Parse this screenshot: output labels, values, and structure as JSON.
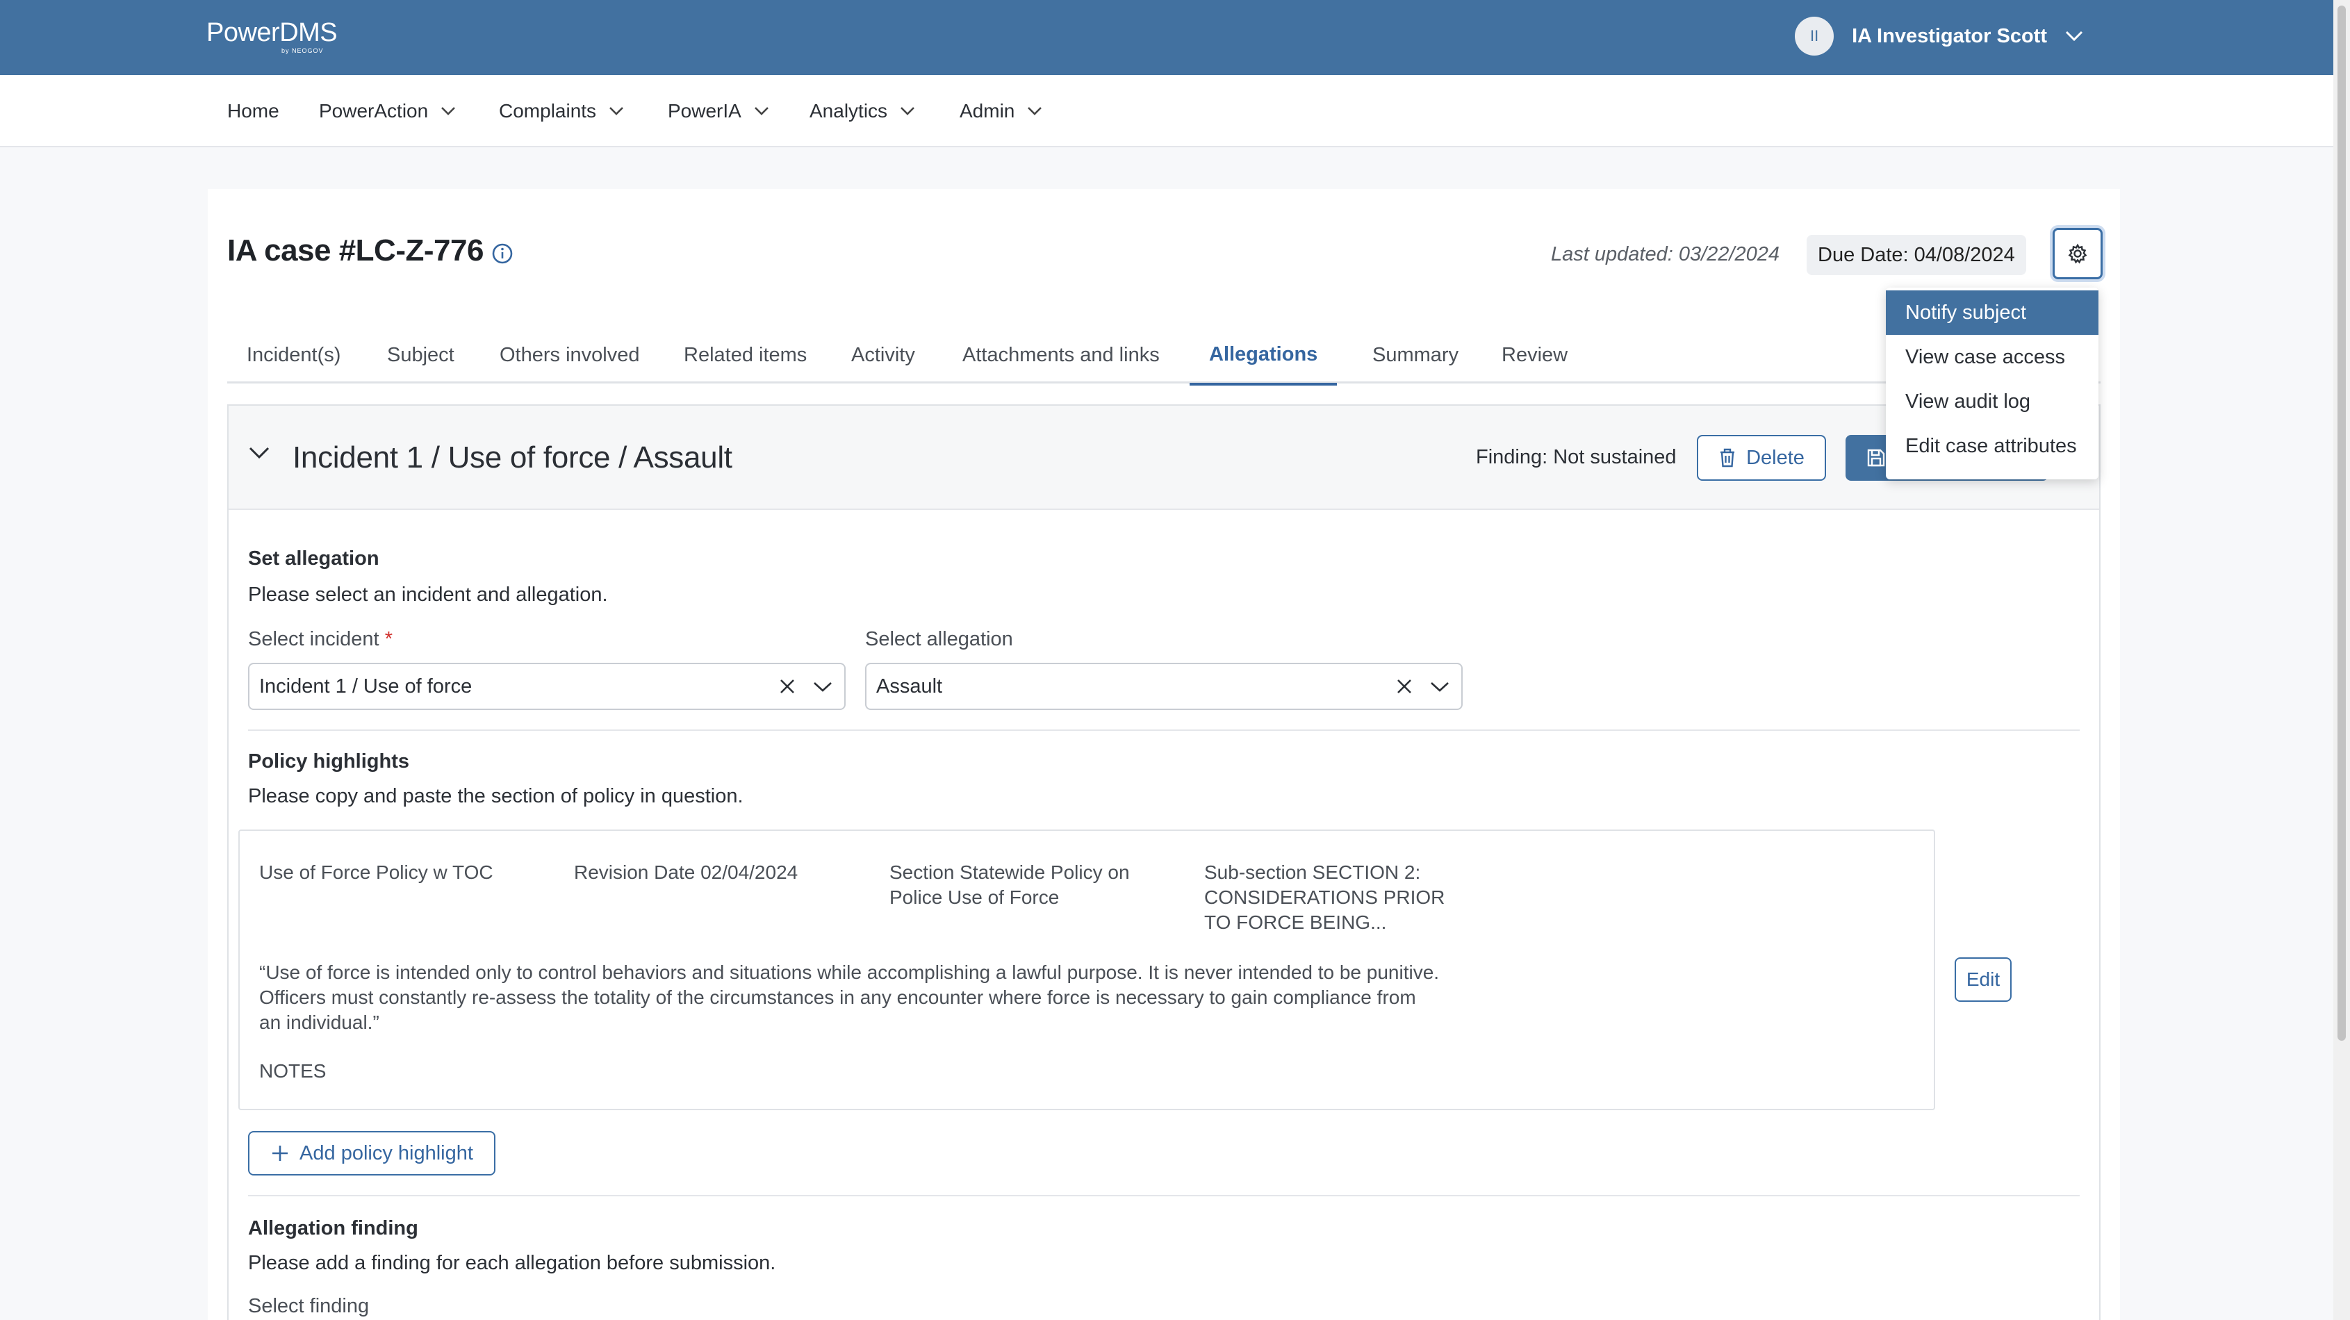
{
  "app": {
    "logo_main": "PowerDMS",
    "logo_sub": "by NEOGOV",
    "user_initials": "II",
    "user_name": "IA Investigator Scott"
  },
  "nav": {
    "items": [
      {
        "label": "Home"
      },
      {
        "label": "PowerAction"
      },
      {
        "label": "Complaints"
      },
      {
        "label": "PowerIA"
      },
      {
        "label": "Analytics"
      },
      {
        "label": "Admin"
      }
    ]
  },
  "case": {
    "title": "IA case #LC-Z-776",
    "last_updated": "Last updated: 03/22/2024",
    "due_date": "Due Date: 04/08/2024"
  },
  "tabs": [
    {
      "label": "Incident(s)"
    },
    {
      "label": "Subject"
    },
    {
      "label": "Others involved"
    },
    {
      "label": "Related items"
    },
    {
      "label": "Activity"
    },
    {
      "label": "Attachments and links"
    },
    {
      "label": "Allegations",
      "active": true
    },
    {
      "label": "Summary"
    },
    {
      "label": "Review"
    }
  ],
  "gear_menu": {
    "items": [
      {
        "label": "Notify subject",
        "active": true
      },
      {
        "label": "View case access"
      },
      {
        "label": "View audit log"
      },
      {
        "label": "Edit case attributes"
      }
    ]
  },
  "allegation": {
    "header": "Incident 1 / Use of force / Assault",
    "finding": "Finding: Not sustained",
    "delete_label": "Delete",
    "set_title": "Set allegation",
    "set_desc": "Please select an incident and allegation.",
    "incident_label": "Select incident",
    "incident_required": "*",
    "incident_value": "Incident 1 / Use of force",
    "allegation_label": "Select allegation",
    "allegation_value": "Assault"
  },
  "policy": {
    "title": "Policy highlights",
    "desc": "Please copy and paste the section of policy in question.",
    "document": "Use of Force Policy w TOC",
    "revision": "Revision Date 02/04/2024",
    "section_line1": "Section Statewide Policy on",
    "section_line2": "Police Use of Force",
    "subsection_line1": "Sub-section SECTION 2:",
    "subsection_line2": "CONSIDERATIONS PRIOR",
    "subsection_line3": "TO FORCE BEING...",
    "quote_line1": "“Use of force is intended only to control behaviors and situations while accomplishing a lawful purpose. It is never intended to be punitive.",
    "quote_line2": "Officers must constantly re-assess the totality of the circumstances in any encounter where force is necessary to gain compliance from",
    "quote_line3": "an individual.”",
    "notes": "NOTES",
    "edit_label": "Edit",
    "add_label": "Add policy highlight"
  },
  "finding_section": {
    "title": "Allegation finding",
    "desc": "Please add a finding for each allegation before submission.",
    "select_label": "Select finding"
  },
  "colors": {
    "brand": "#4271a0",
    "accent": "#3566a0"
  }
}
